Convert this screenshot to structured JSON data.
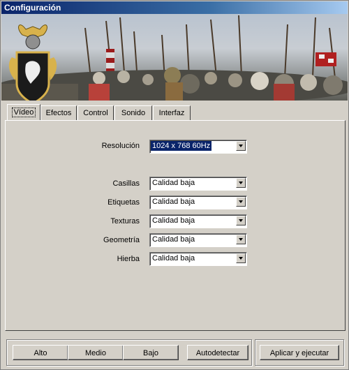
{
  "window": {
    "title": "Configuración"
  },
  "tabs": [
    {
      "label": "Vídeo",
      "active": true
    },
    {
      "label": "Efectos"
    },
    {
      "label": "Control"
    },
    {
      "label": "Sonido"
    },
    {
      "label": "Interfaz"
    }
  ],
  "video": {
    "resolution": {
      "label": "Resolución",
      "value": "1024 x 768 60Hz"
    },
    "settings": [
      {
        "label": "Casillas",
        "value": "Calidad baja"
      },
      {
        "label": "Etiquetas",
        "value": "Calidad baja"
      },
      {
        "label": "Texturas",
        "value": "Calidad baja"
      },
      {
        "label": "Geometría",
        "value": "Calidad baja"
      },
      {
        "label": "Hierba",
        "value": "Calidad baja"
      }
    ]
  },
  "footer": {
    "presets": [
      "Alto",
      "Medio",
      "Bajo"
    ],
    "autodetect": "Autodetectar",
    "apply": "Aplicar y ejecutar"
  },
  "colors": {
    "titlebar": "#0a246a",
    "face": "#d4d0c8",
    "selection": "#0a246a"
  }
}
